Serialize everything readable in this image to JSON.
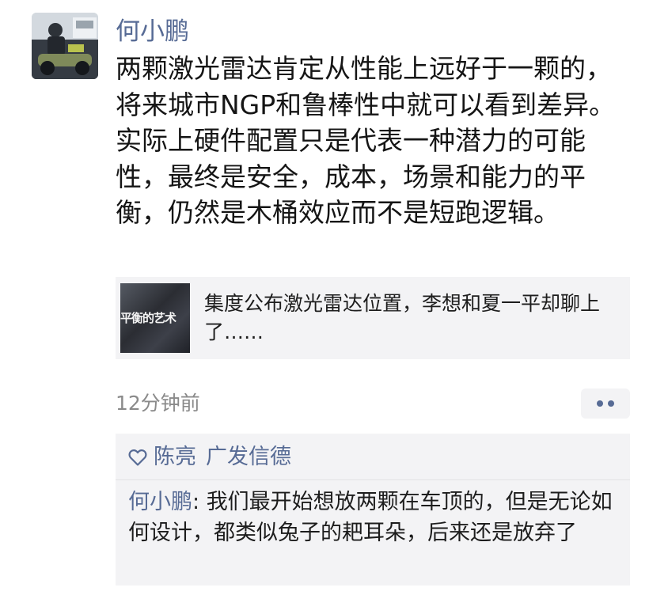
{
  "post": {
    "author": "何小鹏",
    "text": "两颗激光雷达肯定从性能上远好于一颗的，将来城市NGP和鲁棒性中就可以看到差异。实际上硬件配置只是代表一种潜力的可能性，最终是安全，成本，场景和能力的平衡，仍然是木桶效应而不是短跑逻辑。",
    "link": {
      "thumb_text": "平衡的艺术",
      "title": "集度公布激光雷达位置，李想和夏一平却聊上了……"
    },
    "time": "12分钟前"
  },
  "likes": {
    "names": [
      "陈亮",
      "广发信德"
    ]
  },
  "comments": [
    {
      "author": "何小鹏",
      "separator": ": ",
      "text": "我们最开始想放两颗在车顶的，但是无论如何设计，都类似兔子的耙耳朵，后来还是放弃了"
    }
  ],
  "colors": {
    "name_link": "#576b95",
    "card_bg": "#f3f3f5",
    "time_gray": "#8a8a8a"
  }
}
